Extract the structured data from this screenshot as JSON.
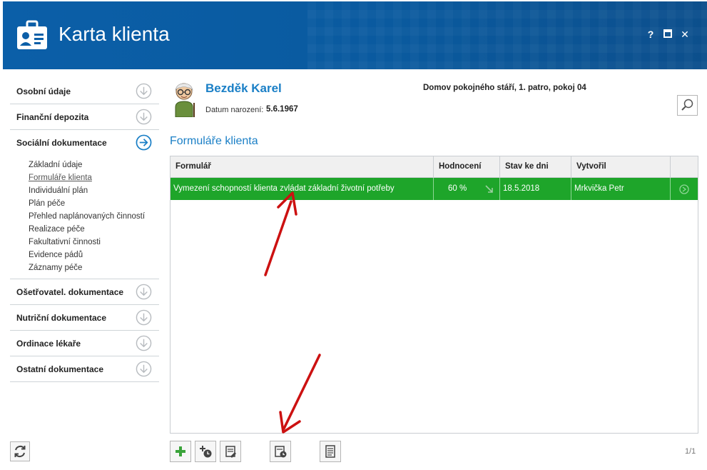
{
  "window": {
    "title": "Karta klienta",
    "help": "?",
    "maximize": "□",
    "close": "✕"
  },
  "sidebar": {
    "sections": [
      {
        "label": "Osobní údaje"
      },
      {
        "label": "Finanční depozita"
      },
      {
        "label": "Sociální dokumentace",
        "items": [
          "Základní údaje",
          "Formuláře klienta",
          "Individuální plán",
          "Plán péče",
          "Přehled naplánovaných činností",
          "Realizace péče",
          "Fakultativní činnosti",
          "Evidence pádů",
          "Záznamy péče"
        ]
      },
      {
        "label": "Ošetřovatel. dokumentace"
      },
      {
        "label": "Nutriční dokumentace"
      },
      {
        "label": "Ordinace lékaře"
      },
      {
        "label": "Ostatní dokumentace"
      }
    ]
  },
  "client": {
    "name": "Bezděk Karel",
    "dob_label": "Datum narození:",
    "dob": "5.6.1967",
    "location": "Domov pokojného stáří, 1. patro, pokoj 04"
  },
  "forms": {
    "title": "Formuláře klienta",
    "columns": [
      "Formulář",
      "Hodnocení",
      "Stav ke dni",
      "Vytvořil"
    ],
    "rows": [
      {
        "form": "Vymezení schopností klienta zvládat základní životní potřeby",
        "rating": "60 %",
        "date": "18.5.2018",
        "author": "Mrkvička Petr"
      }
    ],
    "row_color": "#1ea52a"
  },
  "pager": "1/1",
  "accent": "#1a7fc6",
  "annotation_color": "#cc1111"
}
